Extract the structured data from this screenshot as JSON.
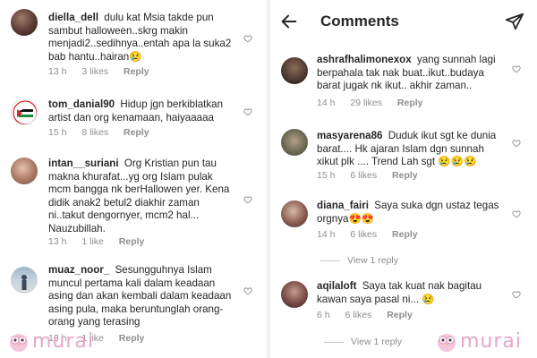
{
  "left_panel": {
    "comments": [
      {
        "username": "diella_dell",
        "text": "dulu kat Msia takde pun sambut halloween..skrg makin menjadi2..sedihnya..entah apa la suka2 bab hantu..hairan😢",
        "time": "13 h",
        "likes": "3 likes",
        "reply": "Reply"
      },
      {
        "username": "tom_danial90",
        "text": "Hidup jgn berkiblatkan artist dan org kenamaan, haiyaaaaa",
        "time": "15 h",
        "likes": "8 likes",
        "reply": "Reply"
      },
      {
        "username": "intan__suriani",
        "text": "Org Kristian pun tau makna khurafat...yg org Islam pulak mcm bangga nk berHallowen yer. Kena didik anak2 betul2 diakhir zaman ni..takut dengornyer, mcm2 hal... Nauzubillah.",
        "time": "13 h",
        "likes": "1 like",
        "reply": "Reply"
      },
      {
        "username": "muaz_noor_",
        "text": "Sesungguhnya Islam muncul pertama kali dalam keadaan asing dan akan kembali dalam keadaan asing pula, maka beruntunglah orang-orang yang terasing",
        "time": "13 h",
        "likes": "1 like",
        "reply": "Reply"
      }
    ]
  },
  "right_panel": {
    "header": {
      "title": "Comments",
      "back_icon": "back-arrow-icon",
      "send_icon": "paper-plane-icon"
    },
    "comments": [
      {
        "username": "ashrafhalimonexox",
        "text": "yang sunnah lagi berpahala tak nak buat..ikut..budaya barat jugak nk ikut.. akhir zaman..",
        "time": "14 h",
        "likes": "29 likes",
        "reply": "Reply"
      },
      {
        "username": "masyarena86",
        "text": "Duduk ikut sgt ke dunia barat.... Hk ajaran Islam dgn sunnah xikut plk .... Trend Lah sgt 😢😢😢",
        "time": "15 h",
        "likes": "6 likes",
        "reply": "Reply"
      },
      {
        "username": "diana_fairi",
        "text": "Saya suka dgn ustaz tegas orgnya😍😍",
        "time": "14 h",
        "likes": "6 likes",
        "reply": "Reply",
        "view_replies": "View 1 reply"
      },
      {
        "username": "aqilaloft",
        "text": "Saya tak kuat nak bagitau kawan saya pasal ni... 😢",
        "time": "6 h",
        "likes": "6 likes",
        "reply": "Reply",
        "view_replies": "View 1 reply"
      }
    ]
  },
  "watermark": {
    "text": "murai"
  },
  "colors": {
    "watermark_pink": "#e9a6c8",
    "meta_gray": "#8e8e8e",
    "text_dark": "#262626"
  }
}
